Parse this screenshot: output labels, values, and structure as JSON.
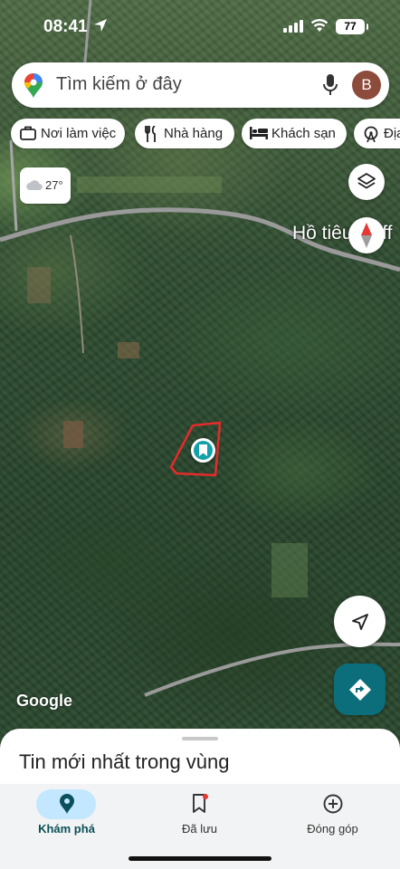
{
  "status_bar": {
    "time": "08:41",
    "battery": "77",
    "icons": [
      "location-arrow-icon",
      "cellular-signal-icon",
      "wifi-icon",
      "battery-icon"
    ]
  },
  "search": {
    "placeholder": "Tìm kiếm ở đây",
    "avatar_initial": "B"
  },
  "chips": [
    {
      "label": "Nơi làm việc",
      "icon": "briefcase-icon"
    },
    {
      "label": "Nhà hàng",
      "icon": "fork-knife-icon"
    },
    {
      "label": "Khách sạn",
      "icon": "bed-icon"
    },
    {
      "label": "Địa",
      "icon": "ferris-wheel-icon"
    }
  ],
  "weather": {
    "temperature": "27°",
    "icon": "cloud-icon"
  },
  "map": {
    "place_label": "Hồ tiêu Coff",
    "attribution": "Google",
    "pin_icon": "bookmark-pin-icon",
    "road_color": "#9a9a9a",
    "boundary_color": "#e52b2b",
    "pin_color": "#14a0a8"
  },
  "sheet": {
    "title": "Tin mới nhất trong vùng"
  },
  "nav": [
    {
      "label": "Khám phá",
      "icon": "location-pin-icon",
      "active": true
    },
    {
      "label": "Đã lưu",
      "icon": "bookmark-icon",
      "badge_color": "#e53935"
    },
    {
      "label": "Đóng góp",
      "icon": "plus-circle-icon"
    }
  ],
  "colors": {
    "accent": "#0b6e7a",
    "active_pill": "#c2e7ff"
  }
}
